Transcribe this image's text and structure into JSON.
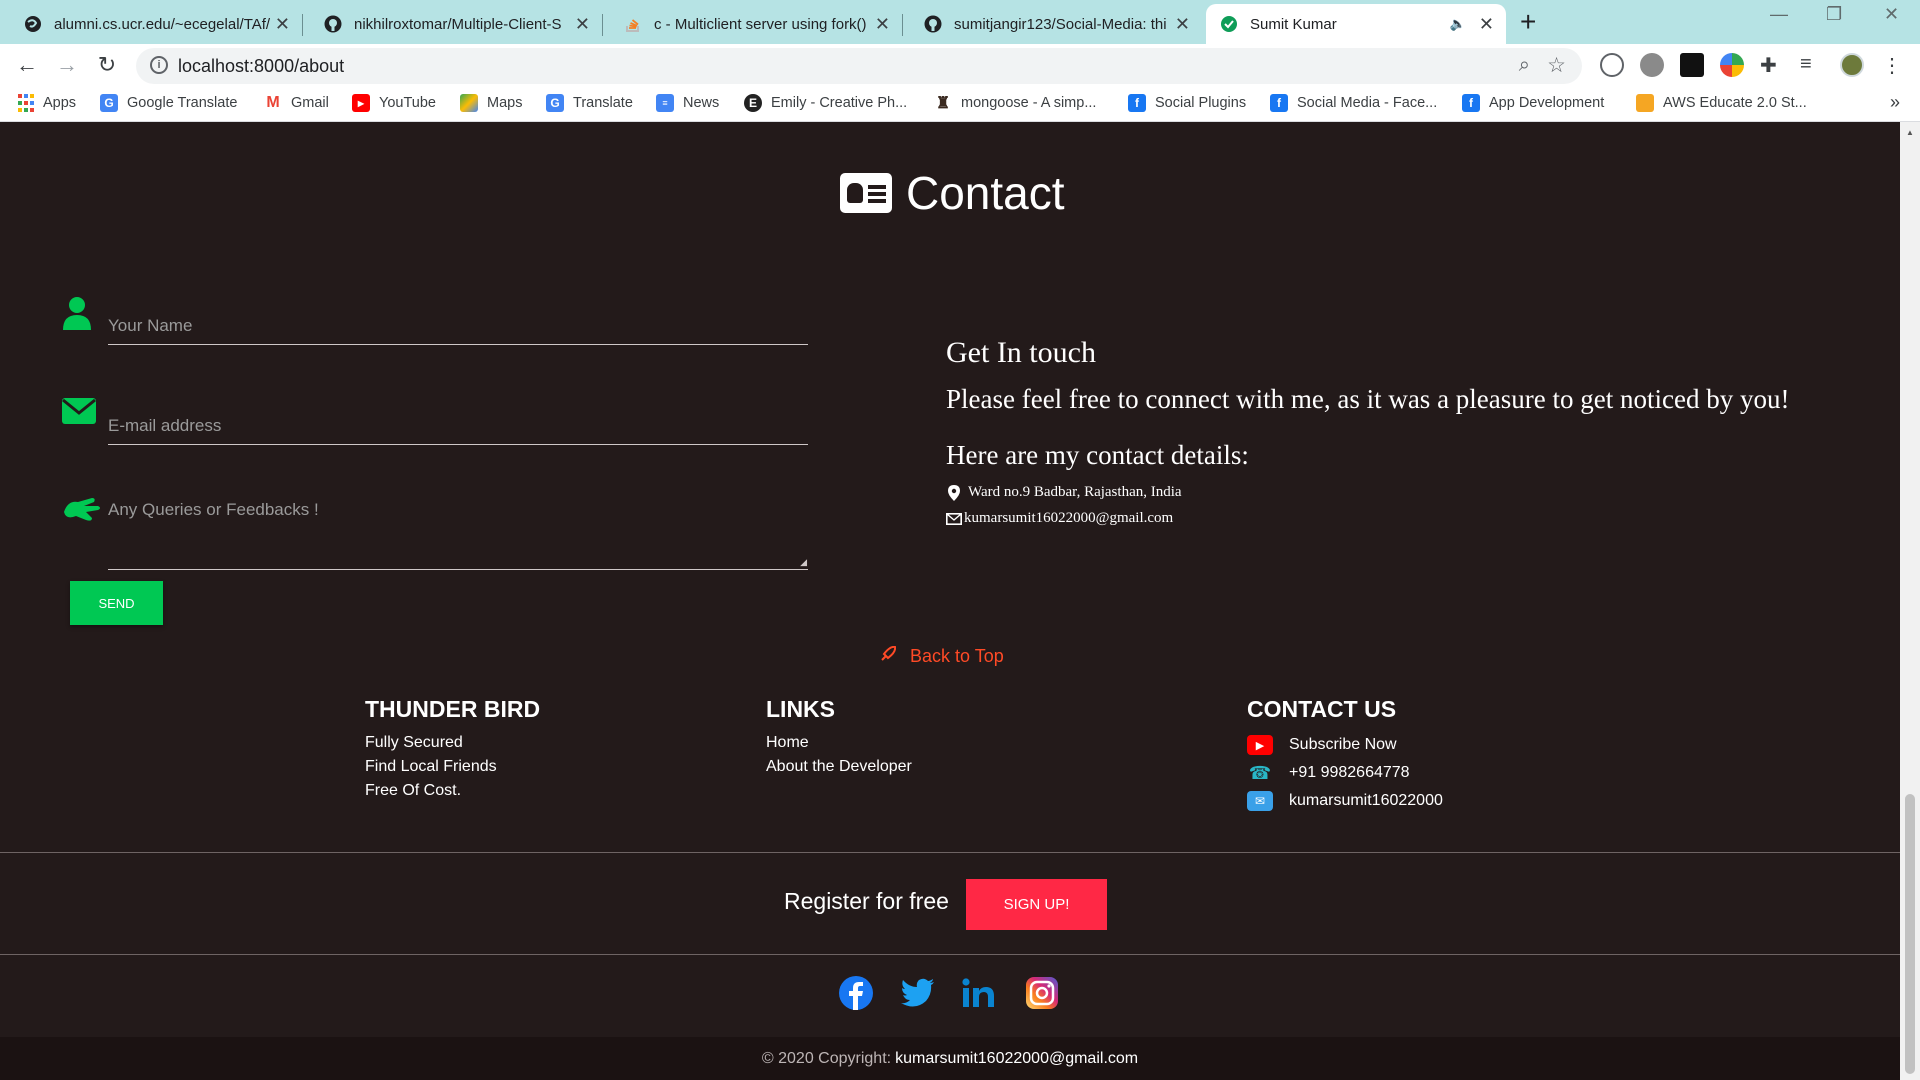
{
  "browser": {
    "tabs": [
      {
        "title": "alumni.cs.ucr.edu/~ecegelal/TAf/",
        "icon": "web-icon"
      },
      {
        "title": "nikhilroxtomar/Multiple-Client-S",
        "icon": "github-icon"
      },
      {
        "title": "c - Multiclient server using fork()",
        "icon": "stackoverflow-icon"
      },
      {
        "title": "sumitjangir123/Social-Media: thi",
        "icon": "github-icon"
      },
      {
        "title": "Sumit Kumar",
        "icon": "check-circle-icon"
      }
    ],
    "new_tab": "+",
    "url": "localhost:8000/about",
    "bookmarks": [
      {
        "label": "Apps",
        "icon": "apps-grid-icon",
        "color": "#4285f4"
      },
      {
        "label": "Google Translate",
        "icon": "google-translate-icon",
        "color": "#4285f4"
      },
      {
        "label": "Gmail",
        "icon": "gmail-icon",
        "color": "#ea4335"
      },
      {
        "label": "YouTube",
        "icon": "youtube-icon",
        "color": "#ff0000"
      },
      {
        "label": "Maps",
        "icon": "maps-icon",
        "color": "#34a853"
      },
      {
        "label": "Translate",
        "icon": "translate-icon",
        "color": "#4285f4"
      },
      {
        "label": "News",
        "icon": "news-icon",
        "color": "#4285f4"
      },
      {
        "label": "Emily - Creative Ph...",
        "icon": "emily-e-icon",
        "color": "#222222"
      },
      {
        "label": "mongoose - A simp...",
        "icon": "mongoose-icon",
        "color": "#3a2a20"
      },
      {
        "label": "Social Plugins",
        "icon": "facebook-icon",
        "color": "#1877f2"
      },
      {
        "label": "Social Media - Face...",
        "icon": "facebook-icon",
        "color": "#1877f2"
      },
      {
        "label": "App Development",
        "icon": "facebook-icon",
        "color": "#1877f2"
      },
      {
        "label": "AWS Educate 2.0 St...",
        "icon": "aws-box-icon",
        "color": "#f5a623"
      }
    ],
    "more": "»"
  },
  "contact": {
    "heading": "Contact",
    "form": {
      "name_placeholder": "Your Name",
      "email_placeholder": "E-mail address",
      "message_placeholder": "Any Queries or Feedbacks !",
      "send_label": "SEND"
    },
    "get_in_touch": {
      "title": "Get In touch",
      "message": "Please feel free to connect with me, as it was a pleasure to get noticed by you!",
      "details_title": "Here are my contact details:",
      "address": "Ward no.9 Badbar, Rajasthan, India",
      "email": "kumarsumit16022000@gmail.com"
    },
    "back_to_top": "Back to Top"
  },
  "footer": {
    "col1": {
      "title": "THUNDER BIRD",
      "items": [
        "Fully Secured",
        "Find Local Friends",
        "Free Of Cost."
      ]
    },
    "col2": {
      "title": "LINKS",
      "items": [
        "Home",
        "About the Developer"
      ]
    },
    "col3": {
      "title": "CONTACT US",
      "items": [
        {
          "label": "Subscribe Now",
          "icon": "youtube-icon"
        },
        {
          "label": "+91 9982664778",
          "icon": "telephone-icon"
        },
        {
          "label": "kumarsumit16022000",
          "icon": "envelope-icon"
        }
      ]
    },
    "register_text": "Register for free",
    "signup_label": "SIGN UP!",
    "social": [
      "facebook-icon",
      "twitter-icon",
      "linkedin-icon",
      "instagram-icon"
    ],
    "copyright_prefix": "© 2020 Copyright:",
    "copyright_email": "kumarsumit16022000@gmail.com"
  },
  "colors": {
    "page_bg": "#231a1a",
    "accent_green": "#00c853",
    "signup_red": "#ff2845",
    "back_to_top": "#ff4a26"
  }
}
